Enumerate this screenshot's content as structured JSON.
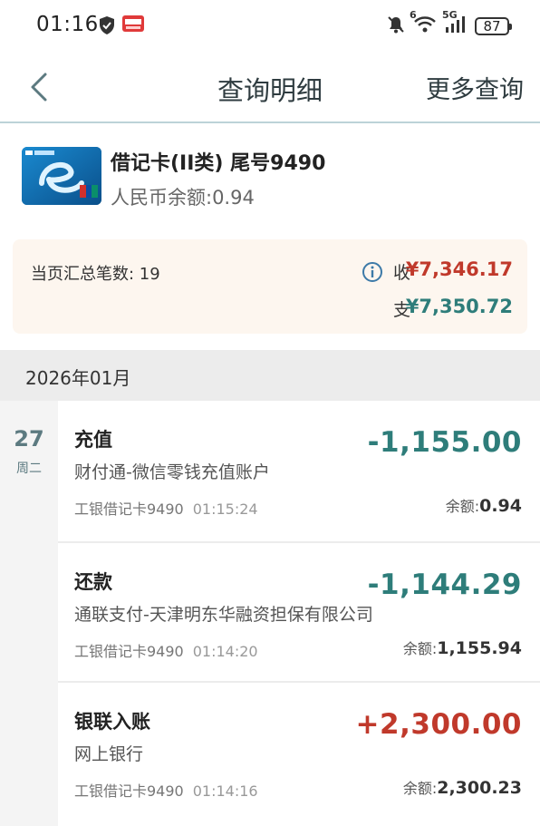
{
  "status_bar": {
    "time": "01:16",
    "network": "5G",
    "signal_super": "6",
    "battery": "87"
  },
  "nav": {
    "title": "查询明细",
    "more_label": "更多查询"
  },
  "card": {
    "title": "借记卡(II类)  尾号9490",
    "balance": "人民币余额:0.94"
  },
  "summary": {
    "count": "当页汇总笔数: 19",
    "in_label": "收",
    "in_value": "¥7,346.17",
    "out_label": "支",
    "out_value": "¥7,350.72"
  },
  "month": "2026年01月",
  "date": {
    "day": "27",
    "weekday": "周二"
  },
  "transactions": [
    {
      "title": "充值",
      "amount": "-1,155.00",
      "desc": "财付通-微信零钱充值账户",
      "card": "工银借记卡9490",
      "time": "01:15:24",
      "balance_label": "余额:",
      "balance": "0.94"
    },
    {
      "title": "还款",
      "amount": "-1,144.29",
      "desc": "通联支付-天津明东华融资担保有限公司",
      "card": "工银借记卡9490",
      "time": "01:14:20",
      "balance_label": "余额:",
      "balance": "1,155.94"
    },
    {
      "title": "银联入账",
      "amount": "+2,300.00",
      "desc": "网上银行",
      "card": "工银借记卡9490",
      "time": "01:14:16",
      "balance_label": "余额:",
      "balance": "2,300.23"
    }
  ],
  "colors": {
    "income": "#c0392b",
    "expense": "#2e7d7a",
    "accent": "#5c7a80"
  }
}
